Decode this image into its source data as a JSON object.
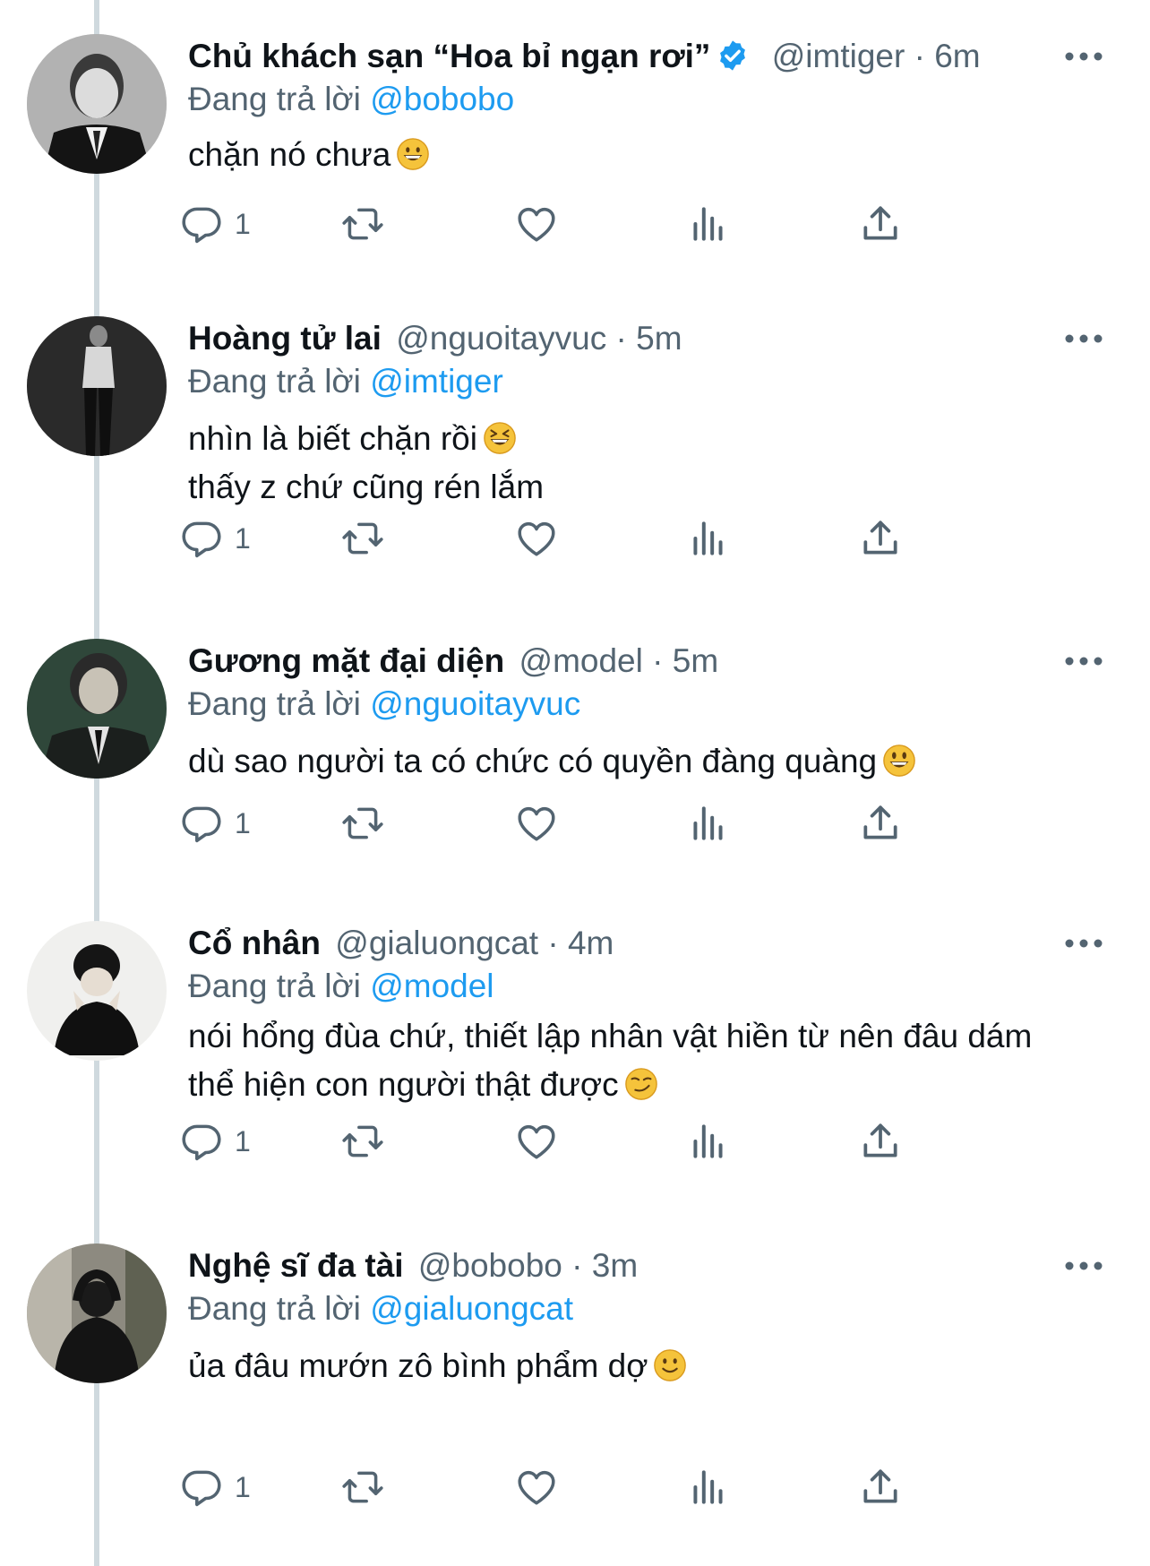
{
  "reply_prefix": "Đang trả lời",
  "dot": "·",
  "tweets": [
    {
      "name": "Chủ khách sạn “Hoa bỉ ngạn rơi”",
      "verified": true,
      "handle": "@imtiger",
      "time": "6m",
      "reply_to": "@bobobo",
      "lines": [
        "chặn nó chưa"
      ],
      "emoji": "grinning-face-emoji",
      "reply_count": "1"
    },
    {
      "name": "Hoàng tử lai",
      "verified": false,
      "handle": "@nguoitayvuc",
      "time": "5m",
      "reply_to": "@imtiger",
      "lines": [
        "nhìn là biết chặn rồi",
        "thấy z chứ cũng rén lắm"
      ],
      "emoji": "squinting-laughing-face-emoji",
      "reply_count": "1"
    },
    {
      "name": "Gương mặt đại diện",
      "verified": false,
      "handle": "@model",
      "time": "5m",
      "reply_to": "@nguoitayvuc",
      "lines": [
        "dù sao người ta có chức có quyền đàng quàng"
      ],
      "emoji": "grinning-big-eyes-emoji",
      "reply_count": "1"
    },
    {
      "name": "Cổ nhân",
      "verified": false,
      "handle": "@gialuongcat",
      "time": "4m",
      "reply_to": "@model",
      "lines": [
        "nói hổng đùa chứ, thiết lập nhân vật hiền từ nên đâu dám",
        "thể hiện con người thật được"
      ],
      "emoji": "smirking-face-emoji",
      "reply_count": "1"
    },
    {
      "name": "Nghệ sĩ đa tài",
      "verified": false,
      "handle": "@bobobo",
      "time": "3m",
      "reply_to": "@gialuongcat",
      "lines": [
        "ủa đâu mướn zô bình phẩm dợ"
      ],
      "emoji": "slightly-smiling-face-emoji",
      "reply_count": "1"
    }
  ],
  "icons": {
    "reply": "reply-icon",
    "retweet": "retweet-icon",
    "like": "heart-icon",
    "views": "views-icon",
    "share": "share-icon",
    "more": "more-icon",
    "verified": "verified-badge-icon"
  },
  "colors": {
    "link": "#1d9bf0",
    "secondary_text": "#536471",
    "thread_line": "#cfd9de",
    "emoji_yellow": "#f5c33b"
  }
}
